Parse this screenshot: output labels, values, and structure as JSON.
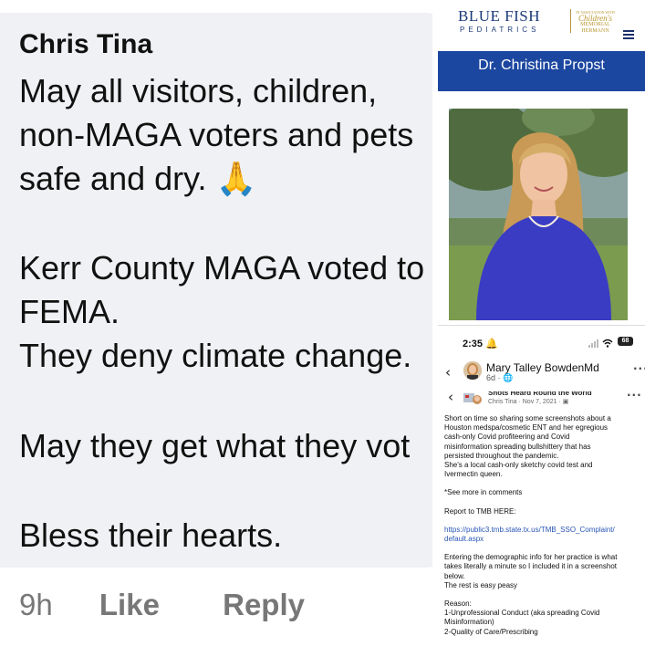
{
  "comment": {
    "author": "Chris Tina",
    "lines": [
      "May all visitors, children,",
      "non-MAGA voters and pets",
      "safe and dry. 🙏",
      "",
      "Kerr County MAGA voted to",
      "FEMA.",
      "They deny climate change.",
      "",
      "May they get what they vot",
      "",
      "Bless their hearts."
    ],
    "time": "9h",
    "like": "Like",
    "reply": "Reply"
  },
  "website": {
    "logo_main": "BLUE FISH",
    "logo_sub": "PEDIATRICS",
    "logo_partner": "IN ASSOCIATION WITH Children's MEMORIAL HERMANN",
    "doctor_name": "Dr. Christina Propst"
  },
  "phone": {
    "status_time": "2:35",
    "battery": "68",
    "poster_name": "Mary Talley BowdenMd",
    "poster_when": "6d · 🌐",
    "inner_title": "Shots Heard Round the World",
    "inner_author": "Chris Tina",
    "inner_date": "Nov 7, 2021",
    "body": [
      [
        "Short on time so sharing some screenshots about a",
        "Houston medspa/cosmetic ENT and her egregious",
        "cash-only Covid profiteering and Covid",
        "misinformation spreading bullshittery that has",
        "persisted throughout the pandemic.",
        "She's a local cash-only sketchy covid test and",
        "Ivermectin queen."
      ],
      [
        "*See more in comments"
      ],
      [
        "Report to TMB HERE:"
      ],
      [
        "https://public3.tmb.state.tx.us/TMB_SSO_Complaint/",
        "default.aspx"
      ],
      [
        "Entering the demographic info for her practice is what",
        "takes literally a minute so I included it in a screenshot",
        "below.",
        "The rest is easy peasy"
      ],
      [
        "Reason:",
        "1-Unprofessional Conduct (aka spreading Covid",
        "Misinformation)",
        "2-Quality of Care/Prescribing"
      ]
    ]
  },
  "colors": {
    "bubble": "#eff1f4",
    "banner": "#1c47a0",
    "brand_navy": "#1c3a7a",
    "link": "#2856b5"
  }
}
